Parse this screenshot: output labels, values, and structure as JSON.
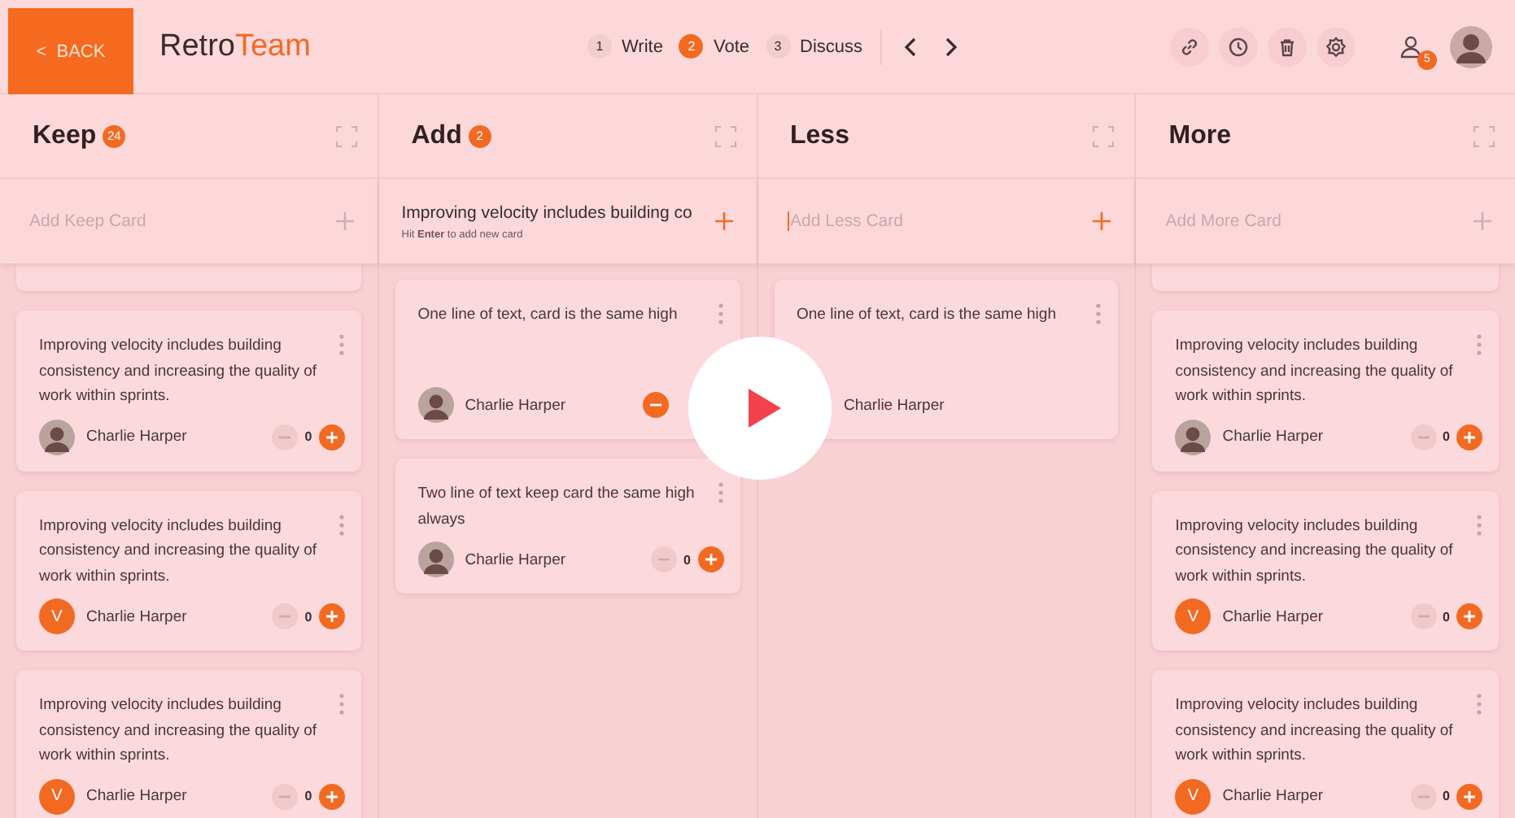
{
  "header": {
    "back": {
      "icon": "<",
      "label": "BACK"
    },
    "logo": {
      "first": "Retro",
      "second": "Team"
    },
    "steps": [
      {
        "number": "1",
        "label": "Write",
        "selected": false
      },
      {
        "number": "2",
        "label": "Vote",
        "selected": true
      },
      {
        "number": "3",
        "label": "Discuss",
        "selected": false
      }
    ],
    "tools": [
      {
        "kind": "link"
      },
      {
        "kind": "clock"
      },
      {
        "kind": "trash"
      },
      {
        "kind": "gear"
      }
    ],
    "participants_badge": "5"
  },
  "columns": [
    {
      "title": "Keep",
      "badge": "24",
      "input": {
        "placeholder": "Add Keep Card",
        "active": false
      },
      "cards": [
        {
          "kind": "stub"
        },
        {
          "kind": "note",
          "text": "Improving velocity includes building consistency and increasing the quality of work within sprints.",
          "author": "Charlie Harper",
          "avatar": {
            "kind": "photo"
          },
          "voted": false,
          "votes": "0"
        },
        {
          "kind": "note",
          "text": "Improving velocity includes building consistency and increasing the quality of work within sprints.",
          "author": "Charlie Harper",
          "avatar": {
            "kind": "letter",
            "letter": "V"
          },
          "voted": false,
          "votes": "0"
        },
        {
          "kind": "note",
          "text": "Improving velocity includes building consistency and increasing the quality of work within sprints.",
          "author": "Charlie Harper",
          "avatar": {
            "kind": "letter",
            "letter": "V"
          },
          "voted": false,
          "votes": "0"
        }
      ]
    },
    {
      "title": "Add",
      "badge": "2",
      "input": {
        "value": "Improving velocity includes building co",
        "hint": "Hit **Enter** to add new card",
        "active": true
      },
      "cards": [
        {
          "kind": "note",
          "tall": true,
          "text": "One line of text, card is the same high",
          "author": "Charlie Harper",
          "avatar": {
            "kind": "photo"
          },
          "voted": true
        },
        {
          "kind": "note",
          "text": "Two line of text keep card the same high always",
          "author": "Charlie Harper",
          "avatar": {
            "kind": "photo"
          },
          "voted": false,
          "votes": "0"
        }
      ]
    },
    {
      "title": "Less",
      "input": {
        "placeholder": "Add Less Card",
        "active": true
      },
      "cards": [
        {
          "kind": "note",
          "tall": true,
          "text": "One line of text, card is the same high",
          "author": "Charlie Harper"
        }
      ]
    },
    {
      "title": "More",
      "input": {
        "placeholder": "Add More Card",
        "active": false
      },
      "cards": [
        {
          "kind": "stub"
        },
        {
          "kind": "note",
          "text": "Improving velocity includes building consistency and increasing the quality of work within sprints.",
          "author": "Charlie Harper",
          "avatar": {
            "kind": "photo"
          },
          "voted": false,
          "votes": "0"
        },
        {
          "kind": "note",
          "text": "Improving velocity includes building consistency and increasing the quality of work within sprints.",
          "author": "Charlie Harper",
          "avatar": {
            "kind": "letter",
            "letter": "V"
          },
          "voted": false,
          "votes": "0"
        },
        {
          "kind": "note",
          "text": "Improving velocity includes building consistency and increasing the quality of work within sprints.",
          "author": "Charlie Harper",
          "avatar": {
            "kind": "letter",
            "letter": "V"
          },
          "voted": false,
          "votes": "0"
        }
      ]
    }
  ]
}
